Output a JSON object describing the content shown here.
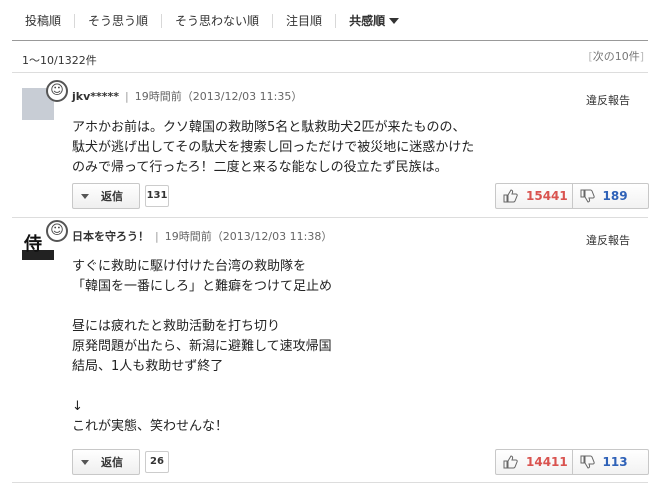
{
  "sort": {
    "tabs": [
      "投稿順",
      "そう思う順",
      "そう思わない順",
      "注目順"
    ],
    "active_label": "共感順"
  },
  "pagination": {
    "count": "1〜10/1322件",
    "next": "次の10件"
  },
  "comments": [
    {
      "user": "jkv*****",
      "time": "19時間前（2013/12/03 11:35）",
      "report": "違反報告",
      "text": "アホかお前は。クソ韓国の救助隊5名と駄救助犬2匹が来たものの、\n駄犬が逃げ出してその駄犬を捜索し回っただけで被災地に迷惑かけた\nのみで帰って行ったろ！二度と来るな能なしの役立たず民族は。",
      "reply_label": "返信",
      "reply_count": "131",
      "agree": "15441",
      "disagree": "189"
    },
    {
      "user": "日本を守ろう！",
      "time": "19時間前（2013/12/03 11:38）",
      "report": "違反報告",
      "text": "すぐに救助に駆け付けた台湾の救助隊を\n「韓国を一番にしろ」と難癖をつけて足止め\n\n昼には疲れたと救助活動を打ち切り\n原発問題が出たら、新潟に避難して速攻帰国\n結局、1人も救助せず終了\n\n↓\nこれが実態、笑わせんな！",
      "reply_label": "返信",
      "reply_count": "26",
      "agree": "14411",
      "disagree": "113"
    }
  ],
  "colors": {
    "agree": "#d9534f",
    "disagree": "#2f62b8"
  }
}
